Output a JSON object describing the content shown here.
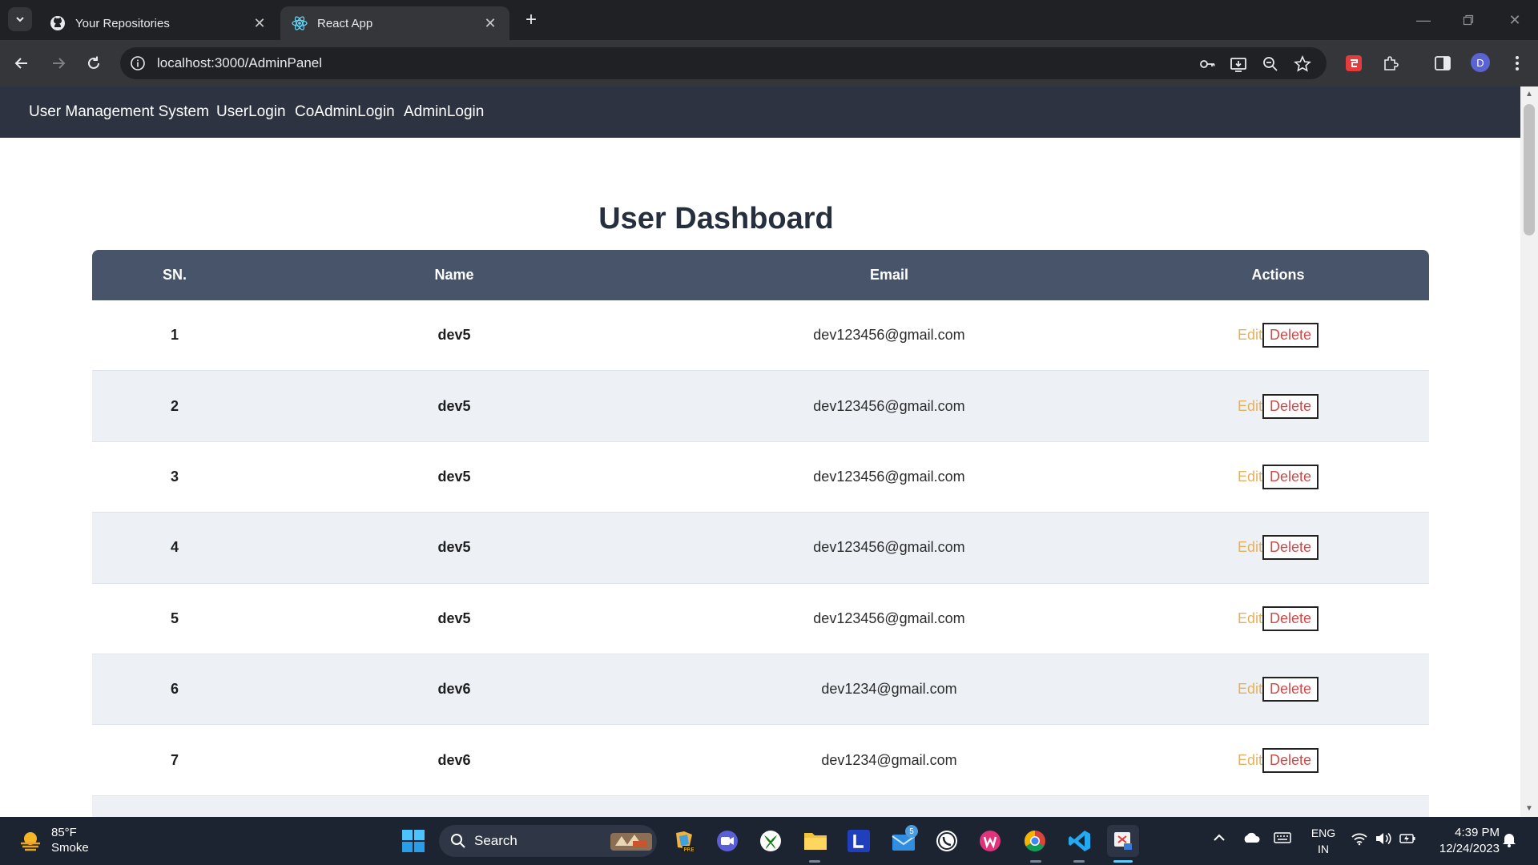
{
  "browser": {
    "tabs": [
      {
        "label": "Your Repositories",
        "active": false,
        "icon": "github-icon"
      },
      {
        "label": "React App",
        "active": true,
        "icon": "react-icon"
      }
    ],
    "url": "localhost:3000/AdminPanel",
    "profile_initial": "D"
  },
  "app": {
    "brand": "User Management System",
    "nav_links": [
      "UserLogin",
      "CoAdminLogin",
      "AdminLogin"
    ],
    "title": "User Dashboard",
    "table": {
      "headers": [
        "SN.",
        "Name",
        "Email",
        "Actions"
      ],
      "edit_label": "Edit",
      "delete_label": "Delete",
      "rows": [
        {
          "sn": "1",
          "name": "dev5",
          "email": "dev123456@gmail.com"
        },
        {
          "sn": "2",
          "name": "dev5",
          "email": "dev123456@gmail.com"
        },
        {
          "sn": "3",
          "name": "dev5",
          "email": "dev123456@gmail.com"
        },
        {
          "sn": "4",
          "name": "dev5",
          "email": "dev123456@gmail.com"
        },
        {
          "sn": "5",
          "name": "dev5",
          "email": "dev123456@gmail.com"
        },
        {
          "sn": "6",
          "name": "dev6",
          "email": "dev1234@gmail.com"
        },
        {
          "sn": "7",
          "name": "dev6",
          "email": "dev1234@gmail.com"
        }
      ]
    }
  },
  "taskbar": {
    "weather_temp": "85°F",
    "weather_desc": "Smoke",
    "search_label": "Search",
    "mail_badge": "5",
    "lang_line1": "ENG",
    "lang_line2": "IN",
    "time": "4:39 PM",
    "date": "12/24/2023"
  },
  "colors": {
    "nav_bg": "#2d3340",
    "table_header_bg": "#485469",
    "edit": "#e6b15c",
    "delete": "#d04a4a"
  }
}
